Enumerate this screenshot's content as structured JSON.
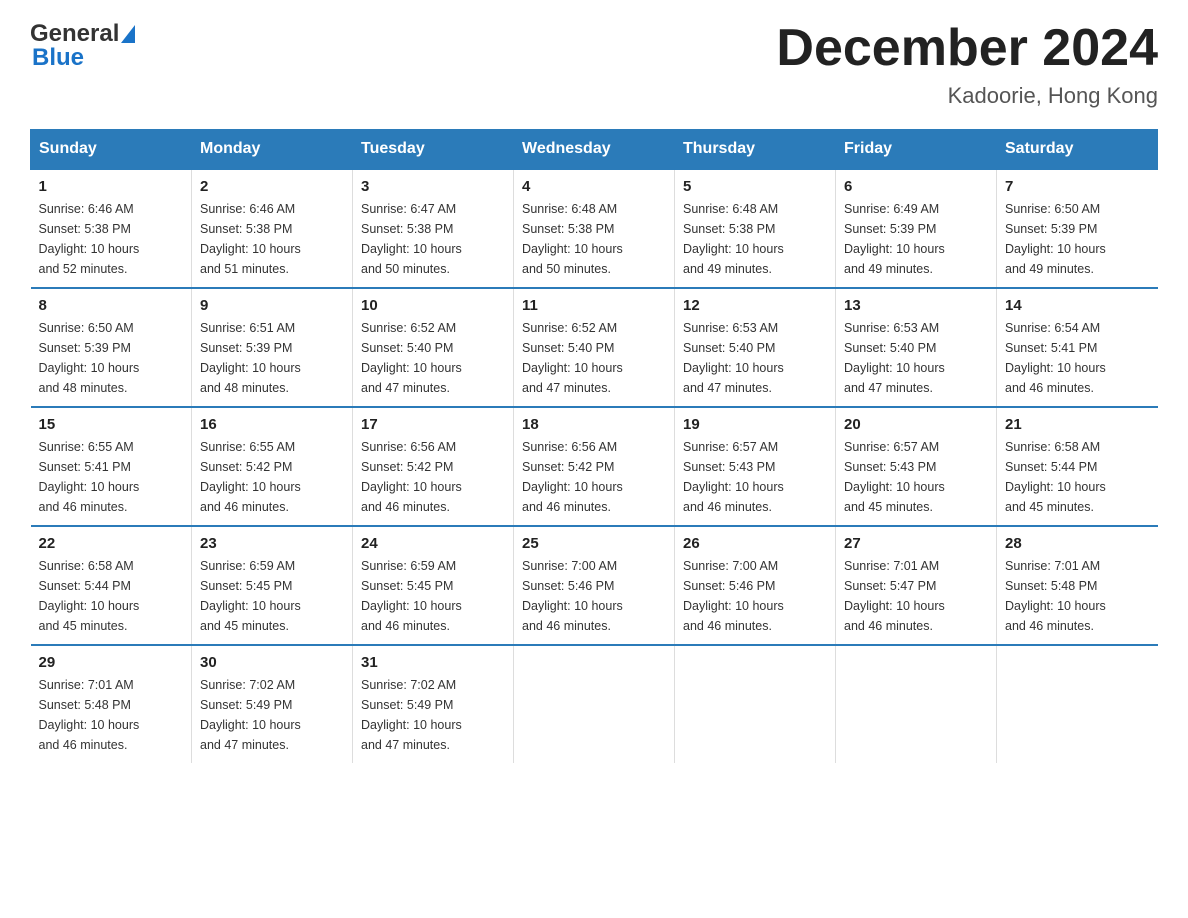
{
  "logo": {
    "general": "General",
    "blue": "Blue"
  },
  "title": "December 2024",
  "subtitle": "Kadoorie, Hong Kong",
  "days_of_week": [
    "Sunday",
    "Monday",
    "Tuesday",
    "Wednesday",
    "Thursday",
    "Friday",
    "Saturday"
  ],
  "weeks": [
    [
      {
        "day": "1",
        "sunrise": "6:46 AM",
        "sunset": "5:38 PM",
        "daylight": "10 hours and 52 minutes."
      },
      {
        "day": "2",
        "sunrise": "6:46 AM",
        "sunset": "5:38 PM",
        "daylight": "10 hours and 51 minutes."
      },
      {
        "day": "3",
        "sunrise": "6:47 AM",
        "sunset": "5:38 PM",
        "daylight": "10 hours and 50 minutes."
      },
      {
        "day": "4",
        "sunrise": "6:48 AM",
        "sunset": "5:38 PM",
        "daylight": "10 hours and 50 minutes."
      },
      {
        "day": "5",
        "sunrise": "6:48 AM",
        "sunset": "5:38 PM",
        "daylight": "10 hours and 49 minutes."
      },
      {
        "day": "6",
        "sunrise": "6:49 AM",
        "sunset": "5:39 PM",
        "daylight": "10 hours and 49 minutes."
      },
      {
        "day": "7",
        "sunrise": "6:50 AM",
        "sunset": "5:39 PM",
        "daylight": "10 hours and 49 minutes."
      }
    ],
    [
      {
        "day": "8",
        "sunrise": "6:50 AM",
        "sunset": "5:39 PM",
        "daylight": "10 hours and 48 minutes."
      },
      {
        "day": "9",
        "sunrise": "6:51 AM",
        "sunset": "5:39 PM",
        "daylight": "10 hours and 48 minutes."
      },
      {
        "day": "10",
        "sunrise": "6:52 AM",
        "sunset": "5:40 PM",
        "daylight": "10 hours and 47 minutes."
      },
      {
        "day": "11",
        "sunrise": "6:52 AM",
        "sunset": "5:40 PM",
        "daylight": "10 hours and 47 minutes."
      },
      {
        "day": "12",
        "sunrise": "6:53 AM",
        "sunset": "5:40 PM",
        "daylight": "10 hours and 47 minutes."
      },
      {
        "day": "13",
        "sunrise": "6:53 AM",
        "sunset": "5:40 PM",
        "daylight": "10 hours and 47 minutes."
      },
      {
        "day": "14",
        "sunrise": "6:54 AM",
        "sunset": "5:41 PM",
        "daylight": "10 hours and 46 minutes."
      }
    ],
    [
      {
        "day": "15",
        "sunrise": "6:55 AM",
        "sunset": "5:41 PM",
        "daylight": "10 hours and 46 minutes."
      },
      {
        "day": "16",
        "sunrise": "6:55 AM",
        "sunset": "5:42 PM",
        "daylight": "10 hours and 46 minutes."
      },
      {
        "day": "17",
        "sunrise": "6:56 AM",
        "sunset": "5:42 PM",
        "daylight": "10 hours and 46 minutes."
      },
      {
        "day": "18",
        "sunrise": "6:56 AM",
        "sunset": "5:42 PM",
        "daylight": "10 hours and 46 minutes."
      },
      {
        "day": "19",
        "sunrise": "6:57 AM",
        "sunset": "5:43 PM",
        "daylight": "10 hours and 46 minutes."
      },
      {
        "day": "20",
        "sunrise": "6:57 AM",
        "sunset": "5:43 PM",
        "daylight": "10 hours and 45 minutes."
      },
      {
        "day": "21",
        "sunrise": "6:58 AM",
        "sunset": "5:44 PM",
        "daylight": "10 hours and 45 minutes."
      }
    ],
    [
      {
        "day": "22",
        "sunrise": "6:58 AM",
        "sunset": "5:44 PM",
        "daylight": "10 hours and 45 minutes."
      },
      {
        "day": "23",
        "sunrise": "6:59 AM",
        "sunset": "5:45 PM",
        "daylight": "10 hours and 45 minutes."
      },
      {
        "day": "24",
        "sunrise": "6:59 AM",
        "sunset": "5:45 PM",
        "daylight": "10 hours and 46 minutes."
      },
      {
        "day": "25",
        "sunrise": "7:00 AM",
        "sunset": "5:46 PM",
        "daylight": "10 hours and 46 minutes."
      },
      {
        "day": "26",
        "sunrise": "7:00 AM",
        "sunset": "5:46 PM",
        "daylight": "10 hours and 46 minutes."
      },
      {
        "day": "27",
        "sunrise": "7:01 AM",
        "sunset": "5:47 PM",
        "daylight": "10 hours and 46 minutes."
      },
      {
        "day": "28",
        "sunrise": "7:01 AM",
        "sunset": "5:48 PM",
        "daylight": "10 hours and 46 minutes."
      }
    ],
    [
      {
        "day": "29",
        "sunrise": "7:01 AM",
        "sunset": "5:48 PM",
        "daylight": "10 hours and 46 minutes."
      },
      {
        "day": "30",
        "sunrise": "7:02 AM",
        "sunset": "5:49 PM",
        "daylight": "10 hours and 47 minutes."
      },
      {
        "day": "31",
        "sunrise": "7:02 AM",
        "sunset": "5:49 PM",
        "daylight": "10 hours and 47 minutes."
      },
      null,
      null,
      null,
      null
    ]
  ],
  "labels": {
    "sunrise": "Sunrise:",
    "sunset": "Sunset:",
    "daylight": "Daylight:"
  }
}
